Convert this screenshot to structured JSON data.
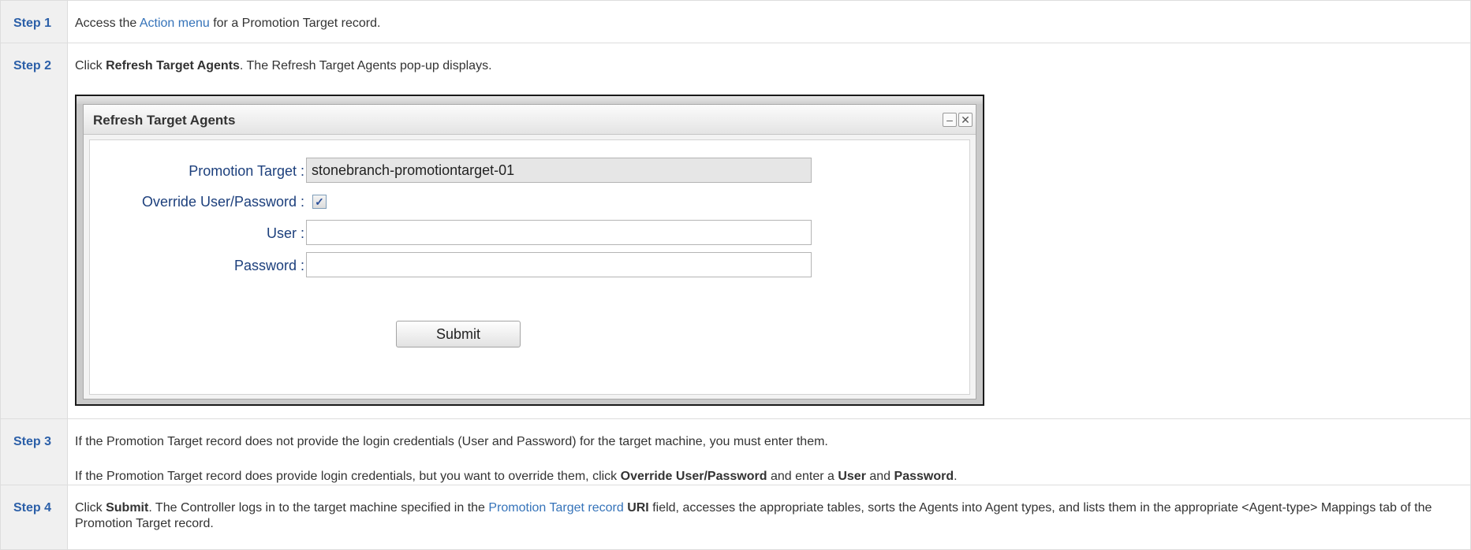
{
  "steps": [
    {
      "label": "Step 1",
      "text_before": "Access the ",
      "link": "Action menu",
      "text_after": " for a Promotion Target record."
    },
    {
      "label": "Step 2",
      "text_before": "Click ",
      "bold": "Refresh Target Agents",
      "text_after": ". The Refresh Target Agents pop-up displays.",
      "dialog": {
        "title": "Refresh Target Agents",
        "minimize_glyph": "–",
        "close_glyph": "✕",
        "fields": {
          "promotion_target_label": "Promotion Target :",
          "promotion_target_value": "stonebranch-promotiontarget-01",
          "override_label": "Override User/Password :",
          "override_checked_glyph": "✓",
          "user_label": "User :",
          "user_value": "",
          "password_label": "Password :",
          "password_value": ""
        },
        "submit_label": "Submit"
      }
    },
    {
      "label": "Step 3",
      "para1": "If the Promotion Target record does not provide the login credentials (User and Password) for the target machine, you must enter them.",
      "para2_t1": "If the Promotion Target record does provide login credentials, but you want to override them, click ",
      "para2_b1": "Override User/Password",
      "para2_t2": " and enter a ",
      "para2_b2": "User",
      "para2_t3": " and ",
      "para2_b3": "Password",
      "para2_t4": "."
    },
    {
      "label": "Step 4",
      "t1": "Click ",
      "b1": "Submit",
      "t2": ". The Controller logs in to the target machine specified in the ",
      "link": "Promotion Target record",
      "t3": " ",
      "b2": "URI",
      "t4": " field, accesses the appropriate tables, sorts the Agents into Agent types, and lists them in the appropriate <Agent-type> Mappings tab of the Promotion Target record."
    }
  ],
  "colors": {
    "step_label": "#2b5fa8",
    "link": "#3573b9",
    "step_cell_bg": "#f0f0f0",
    "border": "#dddddd"
  }
}
